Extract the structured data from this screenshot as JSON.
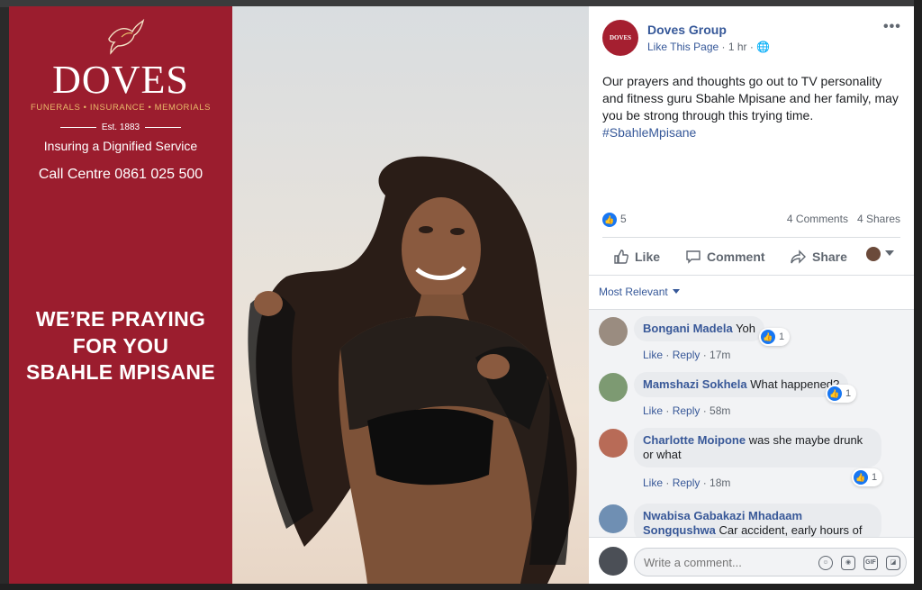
{
  "ad": {
    "brand_name": "DOVES",
    "brand_services": "FUNERALS • INSURANCE • MEMORIALS",
    "established": "Est. 1883",
    "tagline": "Insuring a Dignified Service",
    "call_centre": "Call Centre 0861 025 500",
    "message_line1": "WE’RE PRAYING",
    "message_line2": "FOR YOU",
    "message_line3": "SBAHLE MPISANE",
    "brand_color": "#9b1d2e"
  },
  "post": {
    "page_name": "Doves Group",
    "like_page": "Like This Page",
    "time": "1 hr",
    "text": "Our prayers and thoughts go out to TV personality and fitness guru Sbahle Mpisane and her family, may you be strong through this trying time.",
    "hashtag": "#SbahleMpisane",
    "reactions": "5",
    "comments_count": "4 Comments",
    "shares_count": "4 Shares"
  },
  "actions": {
    "like": "Like",
    "comment": "Comment",
    "share": "Share"
  },
  "filter": "Most Relevant",
  "comments": [
    {
      "name": "Bongani Madela",
      "text": "Yoh",
      "reactions": "1",
      "like": "Like",
      "reply": "Reply",
      "time": "17m"
    },
    {
      "name": "Mamshazi Sokhela",
      "text": "What happened?",
      "reactions": "1",
      "like": "Like",
      "reply": "Reply",
      "time": "58m"
    },
    {
      "name": "Charlotte Moipone",
      "text": "was she maybe drunk or what",
      "reactions": "1",
      "like": "Like",
      "reply": "Reply",
      "time": "18m"
    },
    {
      "name": "Nwabisa Gabakazi Mhadaam Songqushwa",
      "text": "Car accident, early hours of"
    }
  ],
  "composer": {
    "placeholder": "Write a comment...",
    "gif": "GIF"
  }
}
